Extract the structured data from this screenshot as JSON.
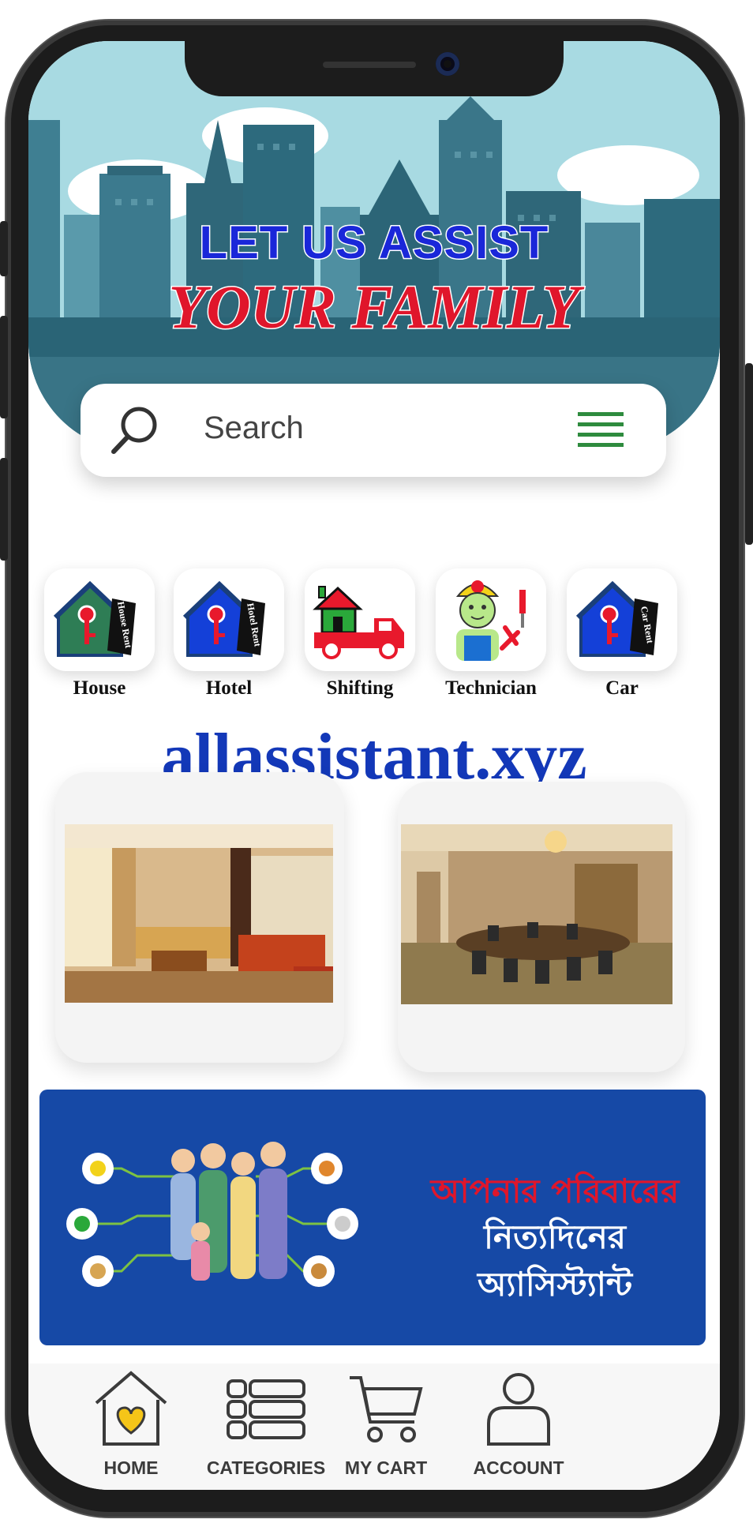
{
  "hero": {
    "line1": "LET US ASSIST",
    "line2": "YOUR FAMILY"
  },
  "search": {
    "placeholder": "Search",
    "menu_icon": "hamburger-menu-icon",
    "search_icon": "search-icon"
  },
  "categories": [
    {
      "label": "House",
      "tag": "House Rent",
      "icon": "house-rent-icon",
      "color": "#2e7d55"
    },
    {
      "label": "Hotel",
      "tag": "Hotel Rent",
      "icon": "hotel-rent-icon",
      "color": "#1440d8"
    },
    {
      "label": "Shifting",
      "icon": "shifting-truck-icon",
      "color": "#e8192c"
    },
    {
      "label": "Technician",
      "icon": "technician-icon",
      "color": "#f2d21a"
    },
    {
      "label": "Car",
      "tag": "Car Rent",
      "icon": "car-rent-icon",
      "color": "#1440d8"
    }
  ],
  "site_domain": "allassistant.xyz",
  "cards": [
    {
      "icon": "hotel-lobby-photo"
    },
    {
      "icon": "conference-room-photo"
    }
  ],
  "banner": {
    "line1": "আপনার পরিবারের",
    "line2": "নিত্যদিনের",
    "line3": "অ্যাসিস্ট্যান্ট",
    "line1_color": "#e0162b",
    "text_color": "#ffffff"
  },
  "tabbar": {
    "home": "HOME",
    "categories": "CATEGORIES",
    "cart": "MY CART",
    "account": "ACCOUNT",
    "active_color": "#f5c518"
  }
}
